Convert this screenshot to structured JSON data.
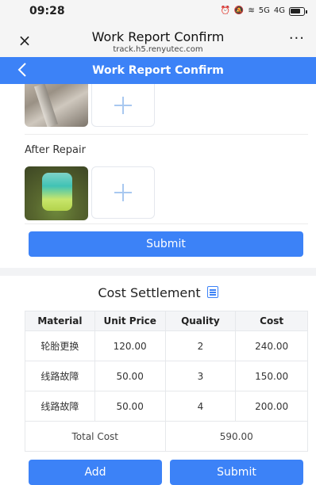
{
  "status_bar": {
    "time": "09:28",
    "signal_5g": "5G",
    "signal_4g": "4G"
  },
  "browser": {
    "close": "×",
    "title": "Work Report Confirm",
    "url": "track.h5.renyutec.com",
    "more": "···"
  },
  "header": {
    "title": "Work Report Confirm"
  },
  "repair": {
    "after_label": "After Repair",
    "submit_label": "Submit"
  },
  "cost": {
    "title": "Cost Settlement",
    "columns": [
      "Material",
      "Unit Price",
      "Quality",
      "Cost"
    ],
    "rows": [
      [
        "轮胎更换",
        "120.00",
        "2",
        "240.00"
      ],
      [
        "线路故障",
        "50.00",
        "3",
        "150.00"
      ],
      [
        "线路故障",
        "50.00",
        "4",
        "200.00"
      ]
    ],
    "total_label": "Total Cost",
    "total_value": "590.00"
  },
  "actions": {
    "add_label": "Add",
    "submit_label": "Submit"
  },
  "colors": {
    "primary": "#3c82f7",
    "plus": "#a8c8f0"
  }
}
